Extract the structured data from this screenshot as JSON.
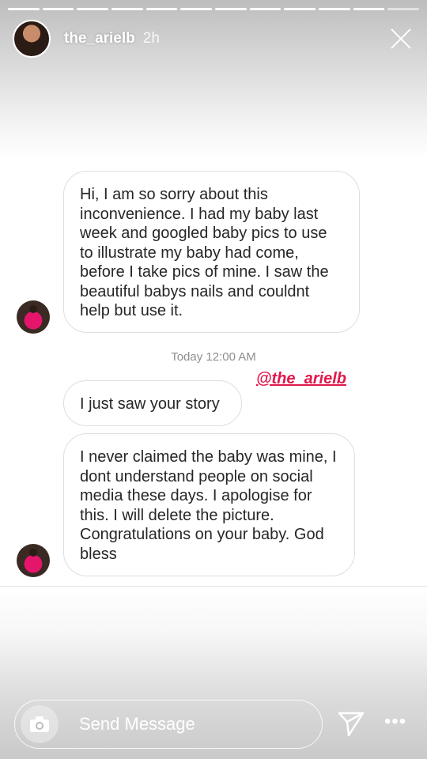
{
  "story": {
    "progress_segments": 12,
    "progress_complete": 11,
    "username": "the_arielb",
    "time": "2h"
  },
  "messages": [
    {
      "text": "Hi, I am so sorry about this inconvenience. I had my baby last week and googled baby pics to use to illustrate my baby had come, before I take pics of mine. I saw the beautiful babys nails and couldnt help but use it."
    },
    {
      "text": "I just saw your story"
    },
    {
      "text": "I never claimed the baby was mine, I dont understand people on social media these days. I apologise for this. I will delete the picture. Congratulations on your baby. God bless"
    }
  ],
  "timestamp": "Today 12:00 AM",
  "mention": "@the_arielb",
  "composer": {
    "placeholder": "Send Message",
    "camera_icon": "camera-icon",
    "send_icon": "send-icon",
    "more_icon": "more-icon",
    "more_glyph": "•••"
  }
}
